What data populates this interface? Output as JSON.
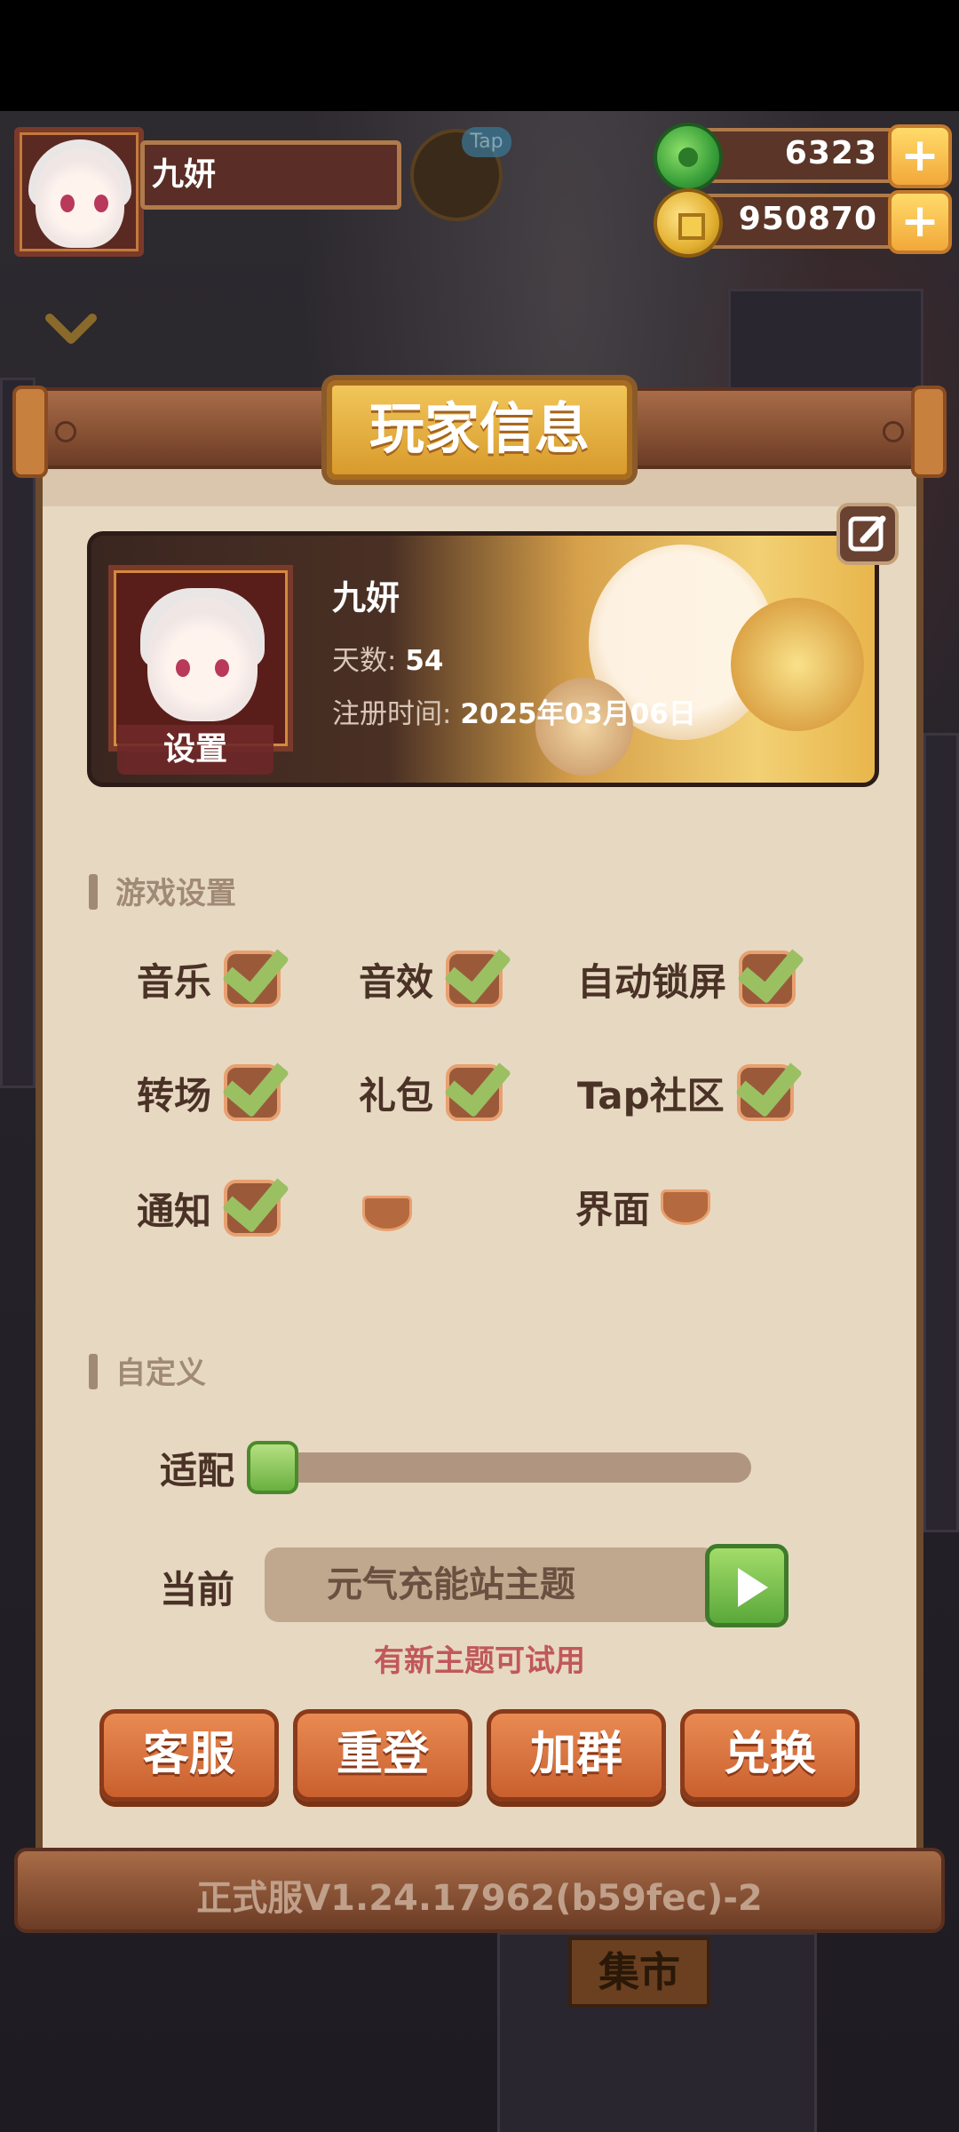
{
  "player": {
    "name": "九妍",
    "days_label": "天数:",
    "days": "54",
    "register_label": "注册时间:",
    "register_date": "2025年03月06日",
    "avatar_button": "设置"
  },
  "hud": {
    "tap_badge": "Tap",
    "jade_amount": "6323",
    "gold_amount": "950870",
    "plus": "+"
  },
  "panel": {
    "title": "玩家信息"
  },
  "game_settings": {
    "heading": "游戏设置",
    "items": [
      {
        "label": "音乐",
        "checked": true
      },
      {
        "label": "音效",
        "checked": true
      },
      {
        "label": "自动锁屏",
        "checked": true
      },
      {
        "label": "转场",
        "checked": true
      },
      {
        "label": "礼包",
        "checked": true
      },
      {
        "label": "Tap社区",
        "checked": true
      },
      {
        "label": "通知",
        "checked": true
      },
      {
        "label": "",
        "checked": false
      },
      {
        "label": "界面",
        "checked": false
      }
    ]
  },
  "custom": {
    "heading": "自定义",
    "fit_label": "适配",
    "fit_value": 0.0,
    "current_label": "当前",
    "current_theme": "元气充能站主题",
    "hint": "有新主题可试用"
  },
  "actions": [
    "客服",
    "重登",
    "加群",
    "兑换"
  ],
  "version": "正式服V1.24.17962(b59fec)-2",
  "background": {
    "market_sign": "集市"
  },
  "colors": {
    "panel_bg": "#e7d8c2",
    "accent_orange": "#d9733e",
    "check_green": "#9ac062",
    "title_gold": "#e2b040",
    "hint_red": "#c0585a"
  }
}
